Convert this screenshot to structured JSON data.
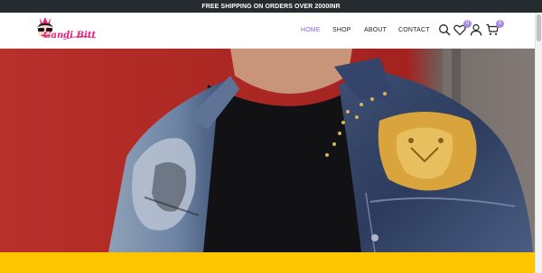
{
  "announcement": "FREE SHIPPING ON ORDERS OVER 2000INR",
  "logo": {
    "text": "Gandi Bitt",
    "brand_color": "#e0207a"
  },
  "nav": {
    "items": [
      {
        "label": "HOME",
        "active": true
      },
      {
        "label": "SHOP",
        "active": false
      },
      {
        "label": "ABOUT",
        "active": false
      },
      {
        "label": "CONTACT",
        "active": false
      }
    ]
  },
  "header_icons": {
    "search": "search-icon",
    "wishlist": {
      "icon": "heart-icon",
      "count": "0"
    },
    "account": "user-icon",
    "cart": {
      "icon": "cart-icon",
      "count": "0"
    }
  },
  "hero": {
    "image": "denim-jacket-with-tiger-patch",
    "band_color": "#fdc400"
  },
  "colors": {
    "topbar": "#262b30",
    "accent": "#8e5ad8",
    "badge": "#a78be6"
  }
}
